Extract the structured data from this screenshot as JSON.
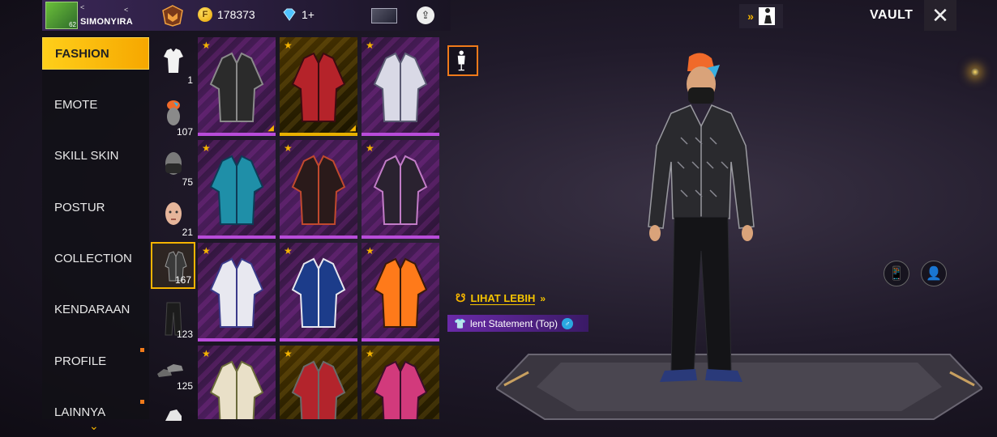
{
  "player": {
    "name": "SIMONYIRA",
    "level": "62"
  },
  "currency": {
    "gold": "178373",
    "diamonds": "1+"
  },
  "header": {
    "vault_label": "VAULT"
  },
  "categories": [
    {
      "label": "FASHION",
      "active": true
    },
    {
      "label": "EMOTE"
    },
    {
      "label": "SKILL SKIN"
    },
    {
      "label": "POSTUR"
    },
    {
      "label": "COLLECTION"
    },
    {
      "label": "KENDARAAN"
    },
    {
      "label": "PROFILE"
    },
    {
      "label": "LAINNYA"
    }
  ],
  "subcategories": [
    {
      "icon": "outfit-set-icon",
      "count": "1"
    },
    {
      "icon": "hair-head-icon",
      "count": "107"
    },
    {
      "icon": "mask-icon",
      "count": "75"
    },
    {
      "icon": "face-icon",
      "count": "21"
    },
    {
      "icon": "top-jacket-icon",
      "count": "167",
      "active": true
    },
    {
      "icon": "pants-icon",
      "count": "123"
    },
    {
      "icon": "shoes-icon",
      "count": "125"
    }
  ],
  "items": [
    {
      "color": "#2b2b2b",
      "accent": "#8a8a8a",
      "equipped": true
    },
    {
      "color": "#b5232a",
      "accent": "#3a0c10",
      "gold": true,
      "equipped": true
    },
    {
      "color": "#d9d9e6",
      "accent": "#5a5a72"
    },
    {
      "color": "#1f8fa8",
      "accent": "#0e3b56"
    },
    {
      "color": "#2a1a1a",
      "accent": "#c0492e"
    },
    {
      "color": "#2a2230",
      "accent": "#c27cc7"
    },
    {
      "color": "#e8e8f0",
      "accent": "#3b3a8a"
    },
    {
      "color": "#1c3c8a",
      "accent": "#e6e6ee"
    },
    {
      "color": "#ff7a1a",
      "accent": "#3a1a0a"
    },
    {
      "color": "#e9e0c8",
      "accent": "#6a6a3a"
    },
    {
      "color": "#b3242c",
      "accent": "#6a6a6a",
      "gold": true
    },
    {
      "color": "#d23a7c",
      "accent": "#3a0e2a",
      "gold": true
    }
  ],
  "selected": {
    "link_label": "LIHAT LEBIH",
    "item_name": "lent Statement (Top)"
  }
}
